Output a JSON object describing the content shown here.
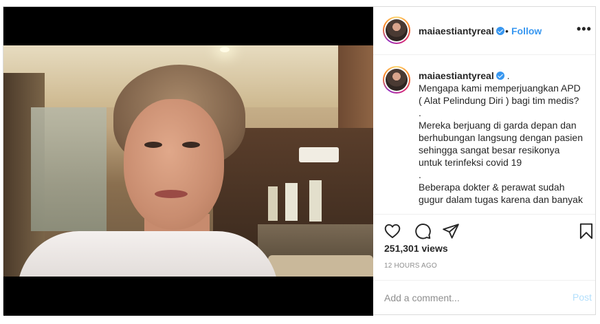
{
  "header": {
    "username": "maiaestiantyreal",
    "separator": "•",
    "follow_label": "Follow",
    "more_icon": "more-horizontal-icon",
    "more_glyph": "•••"
  },
  "caption": {
    "username": "maiaestiantyreal",
    "trail": ".",
    "lines": [
      "Mengapa kami memperjuangkan APD",
      "( Alat Pelindung Diri ) bagi tim medis?",
      ".",
      "Mereka berjuang di garda depan dan",
      "berhubungan langsung dengan pasien",
      "sehingga sangat besar resikonya",
      "untuk terinfeksi covid 19",
      ".",
      "Beberapa dokter & perawat sudah",
      "gugur dalam tugas karena dan banyak"
    ]
  },
  "actions": {
    "like_icon": "heart-icon",
    "comment_icon": "comment-icon",
    "share_icon": "paper-plane-icon",
    "save_icon": "bookmark-icon"
  },
  "stats": {
    "views": "251,301 views",
    "timestamp": "12 HOURS AGO"
  },
  "comment": {
    "placeholder": "Add a comment...",
    "post_label": "Post"
  },
  "colors": {
    "accent": "#3897f0",
    "post_disabled": "#b2dffc",
    "muted": "#8e8e8e",
    "text": "#262626"
  }
}
